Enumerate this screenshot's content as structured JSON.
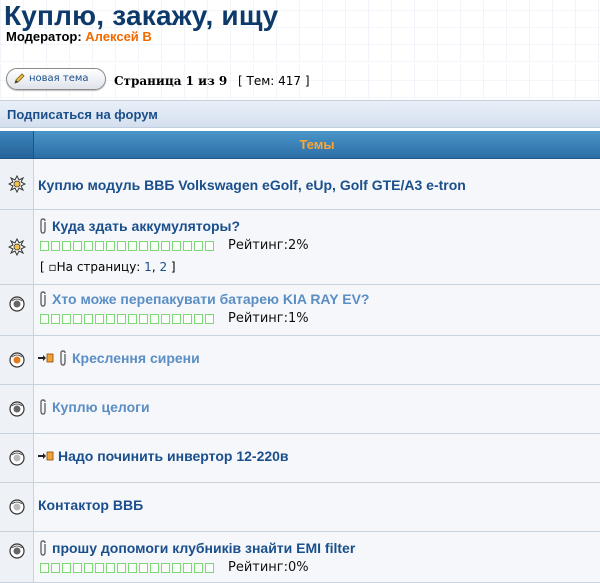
{
  "forum": {
    "title": "Куплю, закажу, ищу",
    "moderator_label": "Модератор:",
    "moderator_name": "Алексей В"
  },
  "toolbar": {
    "new_topic_label": "новая тема",
    "pagination": "Страница 1 из 9",
    "topic_count": "[ Тем: 417 ]"
  },
  "subscribe": {
    "label": "Подписаться на форум"
  },
  "table": {
    "header": "Темы"
  },
  "topics": [
    {
      "title": "Куплю модуль ВВБ Volkswagen eGolf, eUp, Golf GTE/A3 e-tron",
      "icon": "hot-topic-icon",
      "attachment": false,
      "new_arrow": false,
      "rating": null,
      "visited": false
    },
    {
      "title": "Куда здать аккумуляторы?",
      "icon": "hot-topic-icon",
      "attachment": true,
      "new_arrow": false,
      "rating": "Рейтинг:2%",
      "pages_label": "На страницу:",
      "pages": [
        "1",
        "2"
      ],
      "visited": false
    },
    {
      "title": "Хто може перепакувати батарею KIA RAY EV?",
      "icon": "topic-read-icon",
      "attachment": true,
      "new_arrow": false,
      "rating": "Рейтинг:1%",
      "visited": true
    },
    {
      "title": "Креслення сирени",
      "icon": "topic-posted-icon",
      "attachment": true,
      "new_arrow": true,
      "rating": null,
      "visited": true
    },
    {
      "title": "Куплю целоги",
      "icon": "topic-read-icon",
      "attachment": true,
      "new_arrow": false,
      "rating": null,
      "visited": true
    },
    {
      "title": "Надо починить инвертор 12-220в",
      "icon": "topic-unread-icon",
      "attachment": false,
      "new_arrow": true,
      "rating": null,
      "visited": false
    },
    {
      "title": "Контактор ВВБ",
      "icon": "topic-unread-icon",
      "attachment": false,
      "new_arrow": false,
      "rating": null,
      "visited": false
    },
    {
      "title": "прошу допомоги клубників знайти EMI filter",
      "icon": "topic-read-icon",
      "attachment": true,
      "new_arrow": false,
      "rating": "Рейтинг:0%",
      "visited": false
    }
  ],
  "colors": {
    "title": "#0d3a6b",
    "moderator_name": "#f06a00",
    "link": "#1a4f8c",
    "header_text": "#ffa531",
    "rating_star": "#7fd77a"
  }
}
